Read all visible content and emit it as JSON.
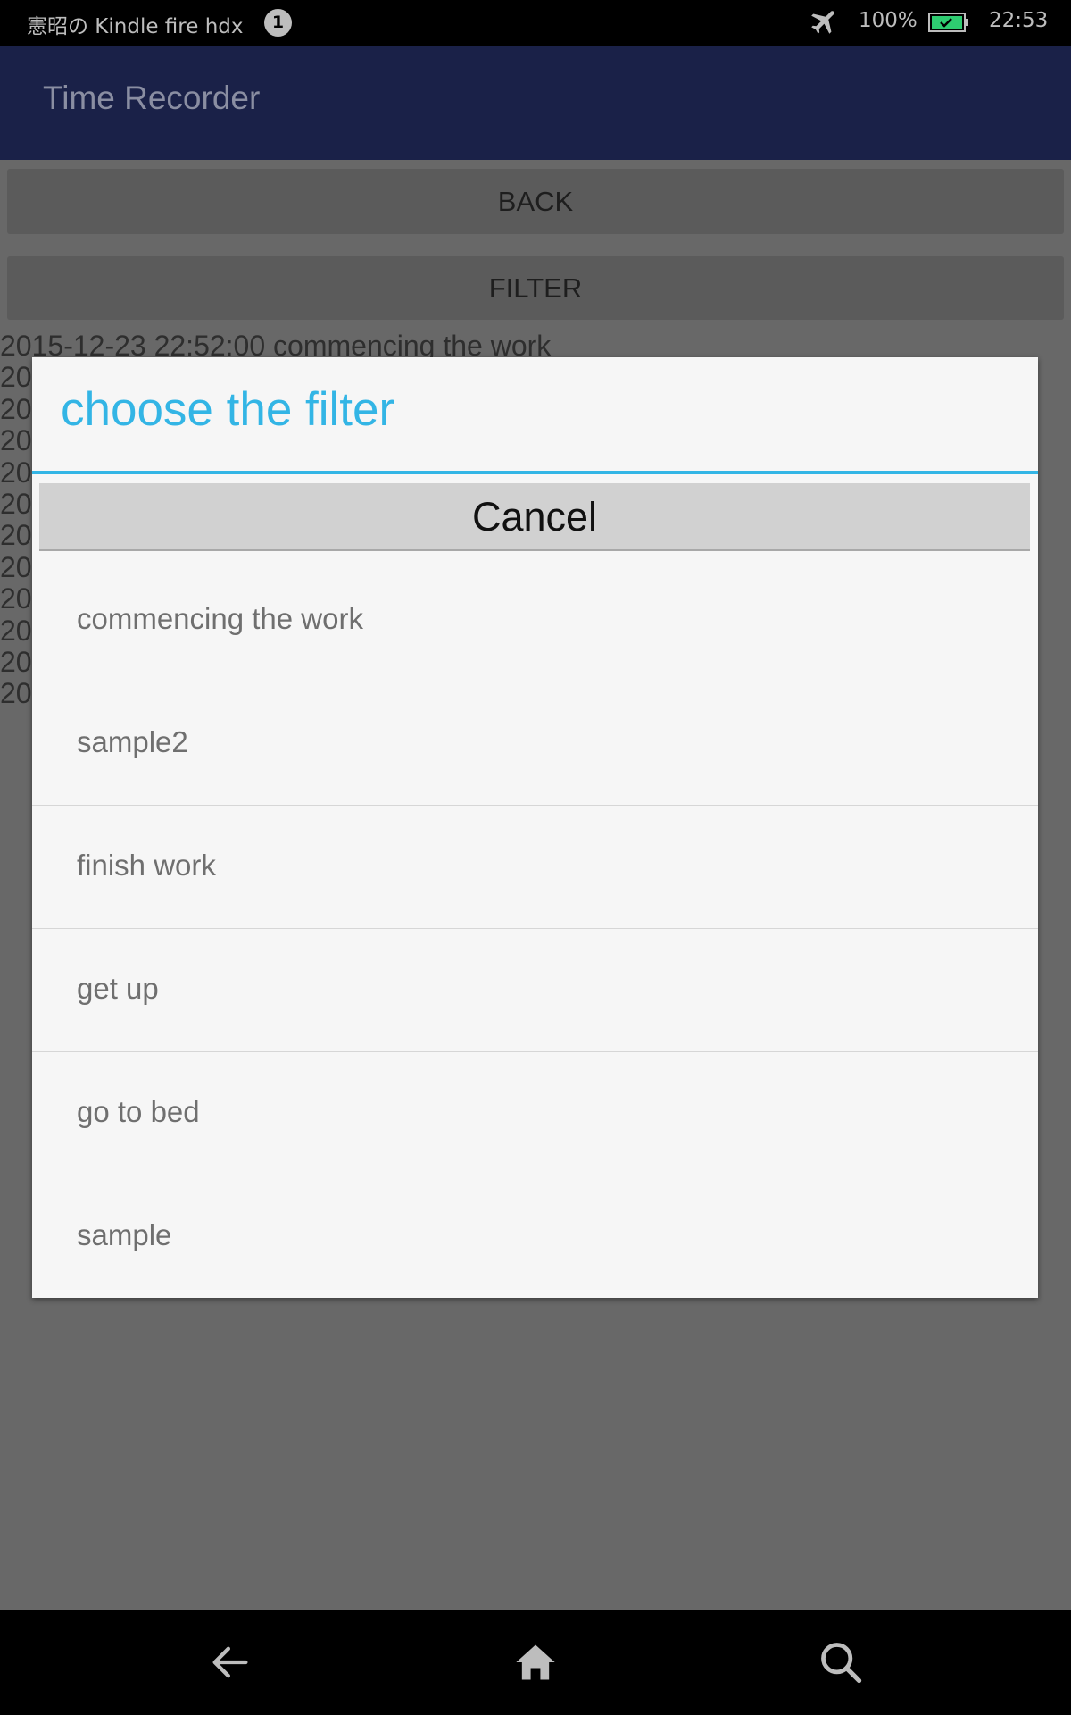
{
  "status_bar": {
    "device_label": "憲昭の  Kindle fire hdx",
    "notification_count": "1",
    "battery_percent": "100%",
    "clock": "22:53",
    "icons": [
      "airplane-mode-icon",
      "battery-icon"
    ]
  },
  "app_bar": {
    "title": "Time Recorder"
  },
  "background": {
    "back_label": "BACK",
    "filter_label": "FILTER",
    "records": [
      "2015-12-23 22:52:00  commencing the work",
      "20",
      "20",
      "20",
      "20",
      "20",
      "20",
      "20",
      "20",
      "20",
      "20",
      "20"
    ]
  },
  "dialog": {
    "title": "choose the filter",
    "cancel_label": "Cancel",
    "options": [
      "commencing the work",
      "sample2",
      "finish work",
      "get up",
      "go to bed",
      "sample"
    ]
  },
  "nav_bar": {
    "icons": [
      "back-arrow-icon",
      "home-icon",
      "search-icon"
    ]
  },
  "colors": {
    "accent": "#33b5e5",
    "app_bar": "#1a2148",
    "scrim": "#686868",
    "dialog_bg": "#f6f6f6",
    "battery_fill": "#2ecc71"
  }
}
